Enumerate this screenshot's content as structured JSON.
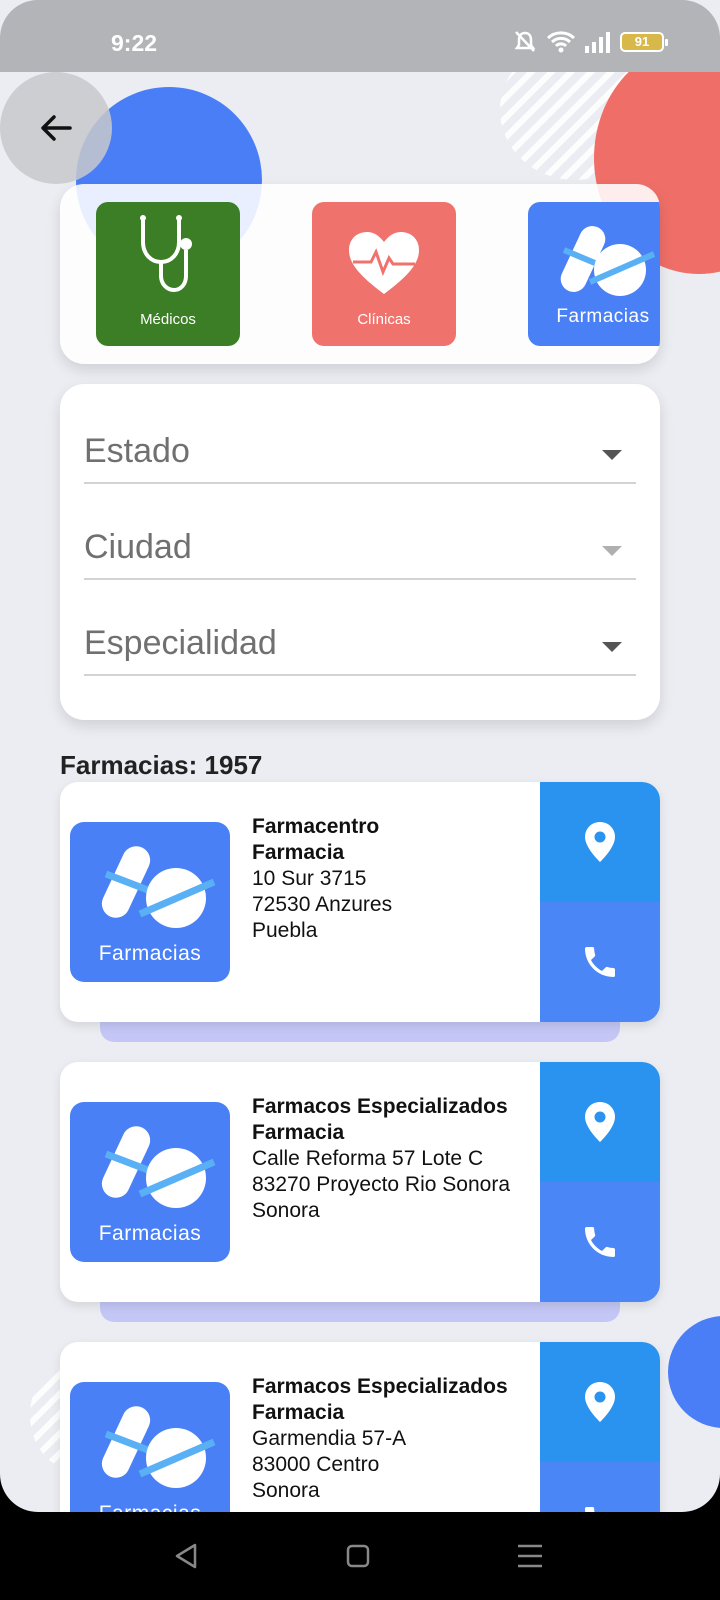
{
  "status_bar": {
    "time": "9:22",
    "battery": "91"
  },
  "categories": [
    {
      "label": "Médicos",
      "icon": "stethoscope-icon",
      "color": "#3b7e25"
    },
    {
      "label": "Clínicas",
      "icon": "heart-pulse-icon",
      "color": "#ef726c"
    },
    {
      "label": "Farmacias",
      "icon": "pills-icon",
      "color": "#4a80f5"
    }
  ],
  "filters": {
    "estado": "Estado",
    "ciudad": "Ciudad",
    "especialidad": "Especialidad"
  },
  "results": {
    "count_label": "Farmacias: 1957",
    "items": [
      {
        "name": "Farmacentro",
        "type": "Farmacia",
        "address": "10 Sur 3715",
        "zip_area": "72530 Anzures",
        "state": "Puebla",
        "logo_label": "Farmacias"
      },
      {
        "name": "Farmacos Especializados",
        "type": "Farmacia",
        "address": "Calle Reforma 57 Lote C",
        "zip_area": "83270 Proyecto Rio Sonora",
        "state": "Sonora",
        "logo_label": "Farmacias"
      },
      {
        "name": "Farmacos Especializados",
        "type": "Farmacia",
        "address": "Garmendia 57-A",
        "zip_area": "83000 Centro",
        "state": "Sonora",
        "logo_label": "Farmacias"
      }
    ]
  },
  "colors": {
    "accent_blue": "#4a80f5",
    "map_blue": "#2a93f0",
    "red": "#ef726c",
    "green": "#3b7e25"
  }
}
